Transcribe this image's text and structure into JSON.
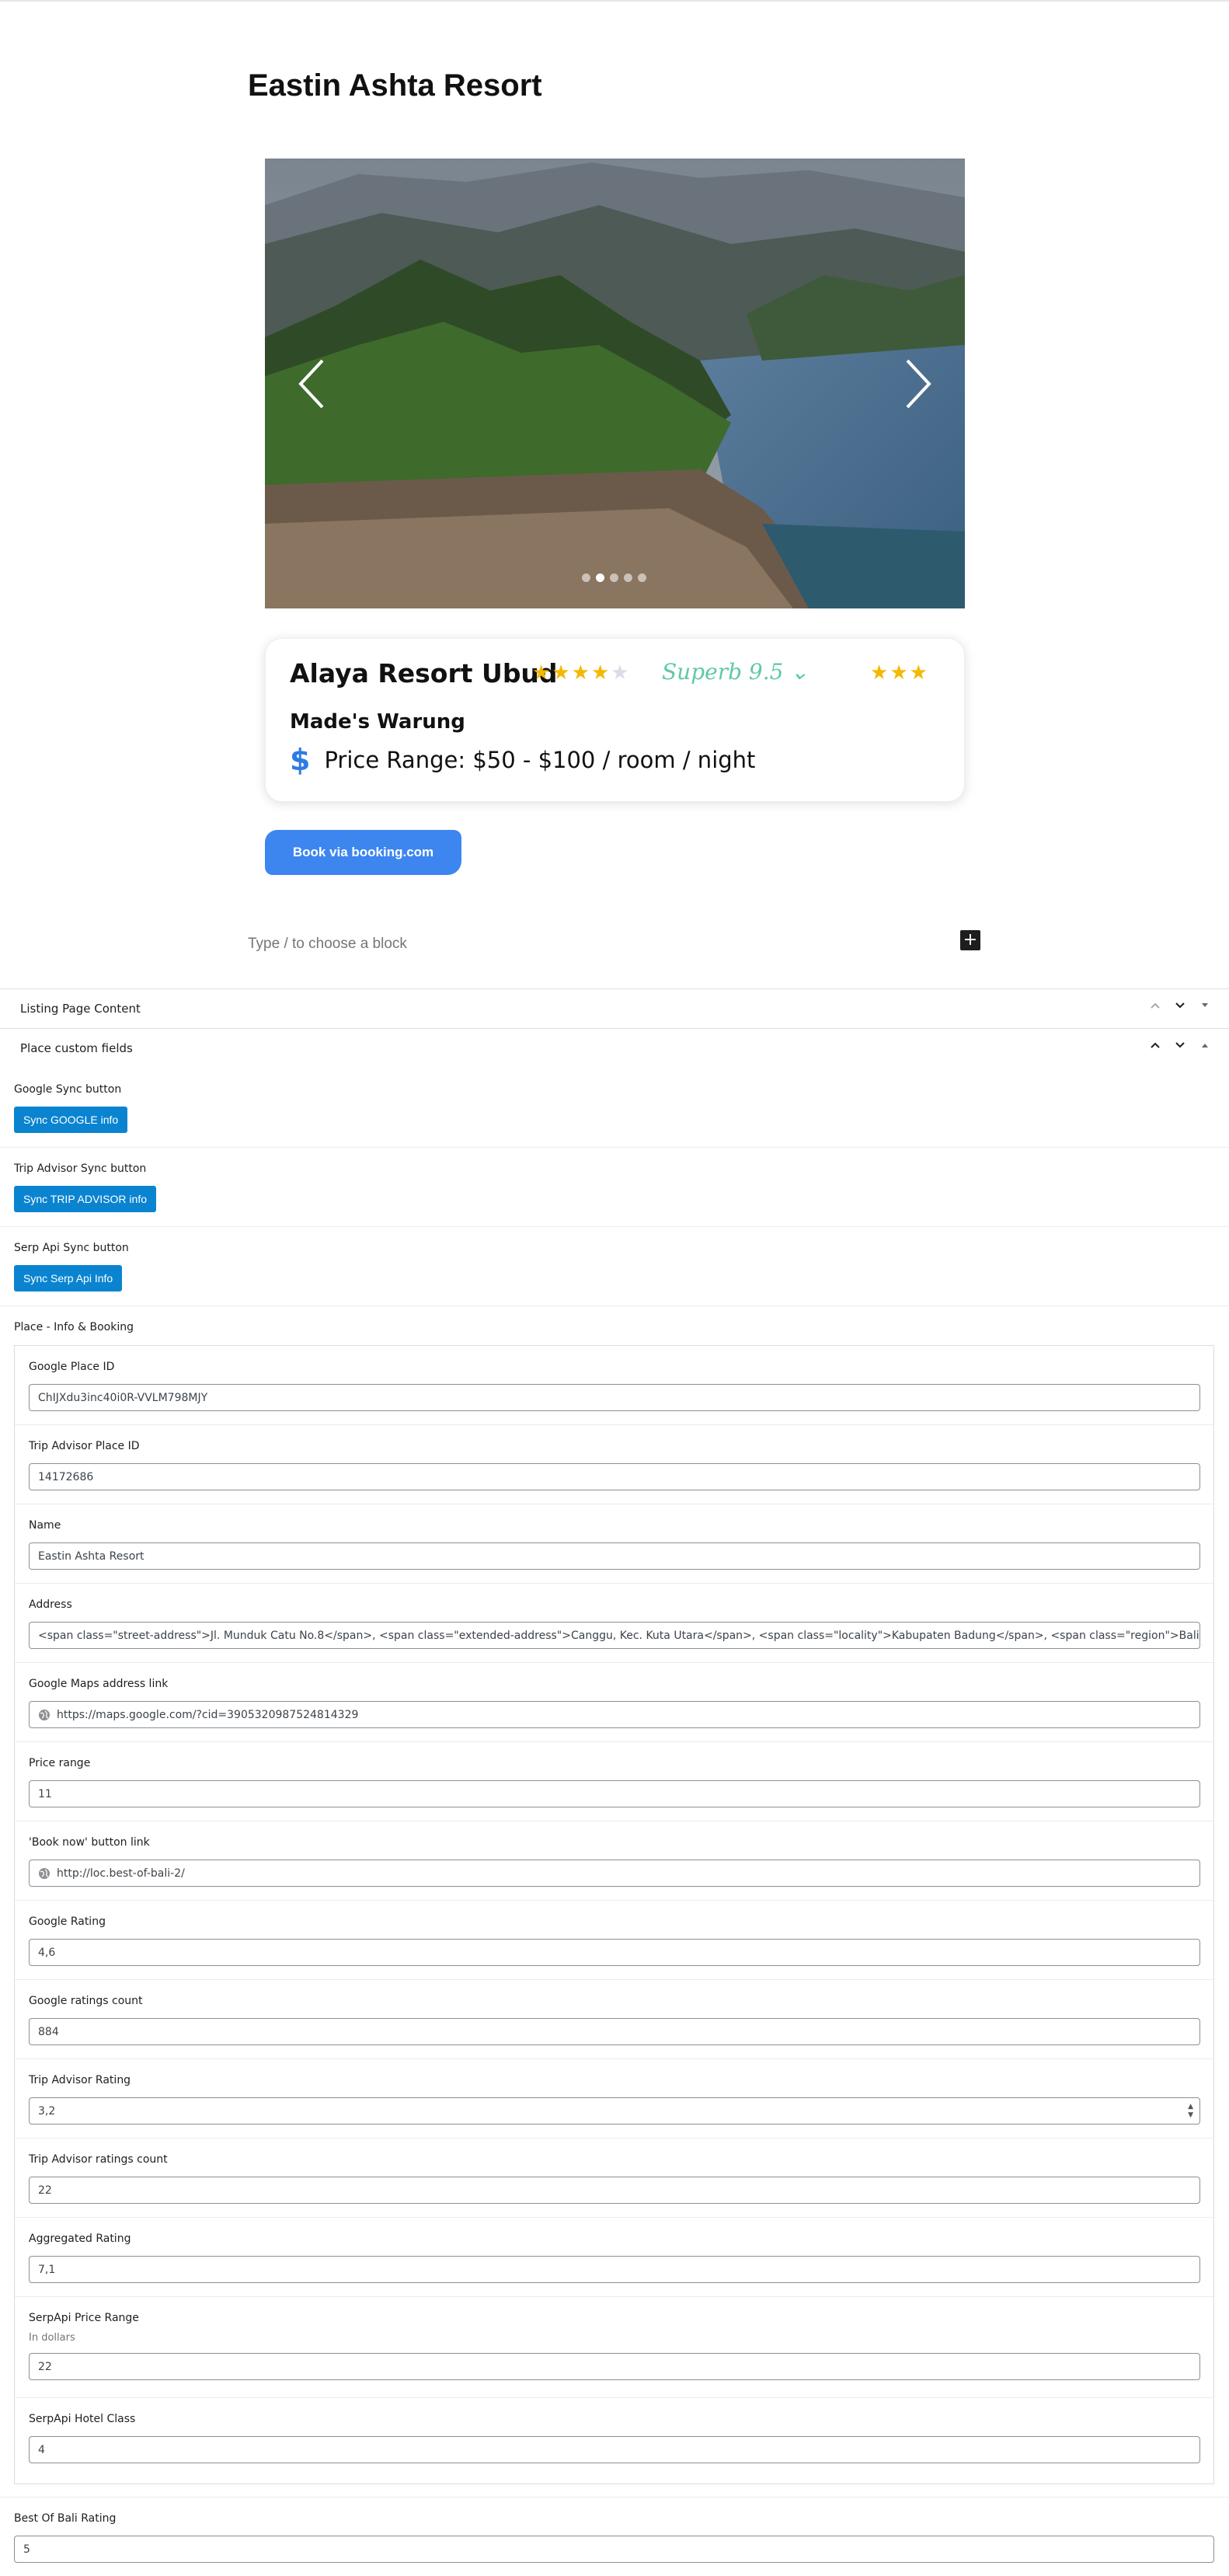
{
  "page": {
    "title": "Eastin Ashta Resort"
  },
  "slider": {
    "dots": 5,
    "active_dot": 2
  },
  "card": {
    "name": "Alaya Resort Ubud",
    "rating_stars": 4,
    "rating_max": 5,
    "review_badge": "Superb 9.5",
    "hotel_class_stars": 3,
    "subtitle": "Made's Warung",
    "price": "Price Range: $50 - $100 / room / night"
  },
  "book_button": {
    "label": "Book via booking.com"
  },
  "block_inserter": {
    "placeholder": "Type / to choose a block"
  },
  "panels": {
    "listing": {
      "title": "Listing Page Content",
      "collapsed": true
    },
    "custom_fields": {
      "title": "Place custom fields",
      "collapsed": false
    }
  },
  "sync": {
    "google": {
      "label": "Google Sync button",
      "button": "Sync GOOGLE info"
    },
    "tripadvisor": {
      "label": "Trip Advisor Sync button",
      "button": "Sync TRIP ADVISOR info"
    },
    "serpapi": {
      "label": "Serp Api Sync button",
      "button": "Sync Serp Api Info"
    }
  },
  "group": {
    "title": "Place - Info & Booking"
  },
  "fields": [
    {
      "label": "Google Place ID",
      "value": "ChIJXdu3inc40i0R-VVLM798MJY",
      "type": "text"
    },
    {
      "label": "Trip Advisor Place ID",
      "value": "14172686",
      "type": "text"
    },
    {
      "label": "Name",
      "value": "Eastin Ashta Resort",
      "type": "text"
    },
    {
      "label": "Address",
      "value": "<span class=\"street-address\">Jl. Munduk Catu No.8</span>, <span class=\"extended-address\">Canggu, Kec. Kuta Utara</span>, <span class=\"locality\">Kabupaten Badung</span>, <span class=\"region\">Bali</span>",
      "type": "text"
    },
    {
      "label": "Google Maps address link",
      "value": "https://maps.google.com/?cid=3905320987524814329",
      "type": "url"
    },
    {
      "label": "Price range",
      "value": "11",
      "type": "text"
    },
    {
      "label": "'Book now' button link",
      "value": "http://loc.best-of-bali-2/",
      "type": "url"
    },
    {
      "label": "Google Rating",
      "value": "4,6",
      "type": "text"
    },
    {
      "label": "Google ratings count",
      "value": "884",
      "type": "text"
    },
    {
      "label": "Trip Advisor Rating",
      "value": "3,2",
      "type": "number"
    },
    {
      "label": "Trip Advisor ratings count",
      "value": "22",
      "type": "text"
    },
    {
      "label": "Aggregated Rating",
      "value": "7,1",
      "type": "text"
    },
    {
      "label": "SerpApi Price Range",
      "description": "In dollars",
      "value": "22",
      "type": "text"
    },
    {
      "label": "SerpApi Hotel Class",
      "value": "4",
      "type": "text"
    }
  ],
  "best_of_bali": {
    "label": "Best Of Bali Rating",
    "value": "5"
  },
  "colors": {
    "primary_button": "#0a84d0",
    "book_button": "#3d86f0",
    "star": "#f5b800",
    "badge": "#5fc9a6",
    "dollar": "#2f7be6"
  }
}
